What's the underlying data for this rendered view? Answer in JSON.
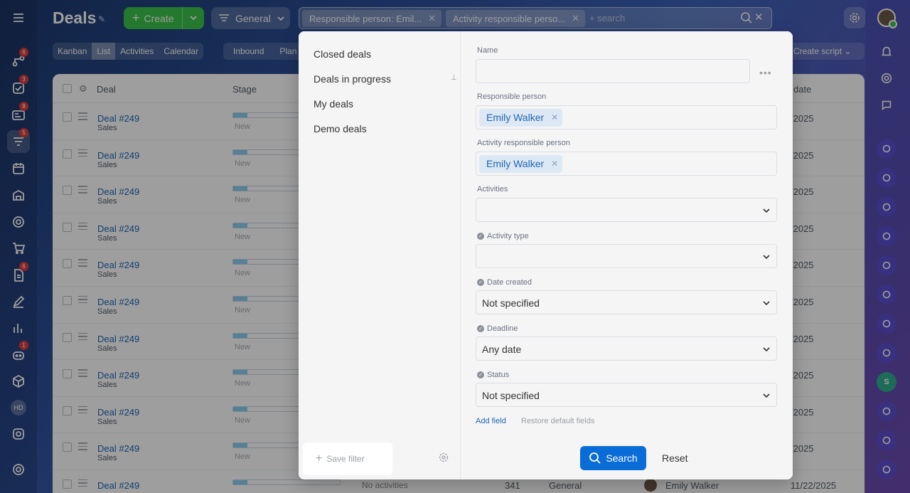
{
  "header": {
    "title": "Deals",
    "create_label": "Create",
    "general_label": "General",
    "search_placeholder": "+ search",
    "chips": [
      "Responsible person: Emil...",
      "Activity responsible perso..."
    ]
  },
  "views": [
    "Kanban",
    "List",
    "Activities",
    "Calendar"
  ],
  "inbound": {
    "label": "Inbound",
    "next": "Plan"
  },
  "create_script_label": "Create script",
  "sidebar_badges": {
    "b1": "6",
    "b2": "3",
    "b3": "8",
    "b4": "5",
    "b5": "6",
    "b6": "1"
  },
  "hd_label": "HD",
  "right_s": "S",
  "table": {
    "headers": {
      "deal": "Deal",
      "stage": "Stage",
      "date": "date"
    },
    "rows": [
      {
        "deal": "Deal #249",
        "cat": "Sales",
        "stage": "New",
        "date": "/2025"
      },
      {
        "deal": "Deal #249",
        "cat": "Sales",
        "stage": "New",
        "date": "/2025"
      },
      {
        "deal": "Deal #249",
        "cat": "Sales",
        "stage": "New",
        "date": "/2025"
      },
      {
        "deal": "Deal #249",
        "cat": "Sales",
        "stage": "New",
        "date": "/2025"
      },
      {
        "deal": "Deal #249",
        "cat": "Sales",
        "stage": "New",
        "date": "/2025"
      },
      {
        "deal": "Deal #249",
        "cat": "Sales",
        "stage": "New",
        "date": "/2025"
      },
      {
        "deal": "Deal #249",
        "cat": "Sales",
        "stage": "New",
        "date": "/2025"
      },
      {
        "deal": "Deal #249",
        "cat": "Sales",
        "stage": "New",
        "date": "/2025"
      },
      {
        "deal": "Deal #249",
        "cat": "Sales",
        "stage": "New",
        "date": "/2025"
      },
      {
        "deal": "Deal #249",
        "cat": "Sales",
        "stage": "New",
        "date": "/2025"
      }
    ],
    "last_row": {
      "deal": "Deal #249",
      "activities": "No activities",
      "num": "341",
      "type": "General",
      "person": "Emily Walker",
      "date": "11/22/2025"
    }
  },
  "filter": {
    "presets": [
      "Closed deals",
      "Deals in progress",
      "My deals",
      "Demo deals"
    ],
    "save_filter": "Save filter",
    "fields": {
      "name_label": "Name",
      "resp_label": "Responsible person",
      "resp_value": "Emily Walker",
      "act_resp_label": "Activity responsible person",
      "act_resp_value": "Emily Walker",
      "activities_label": "Activities",
      "activity_type_label": "Activity type",
      "date_created_label": "Date created",
      "date_created_value": "Not specified",
      "deadline_label": "Deadline",
      "deadline_value": "Any date",
      "status_label": "Status",
      "status_value": "Not specified"
    },
    "add_field": "Add field",
    "restore": "Restore default fields",
    "search_btn": "Search",
    "reset_btn": "Reset"
  }
}
